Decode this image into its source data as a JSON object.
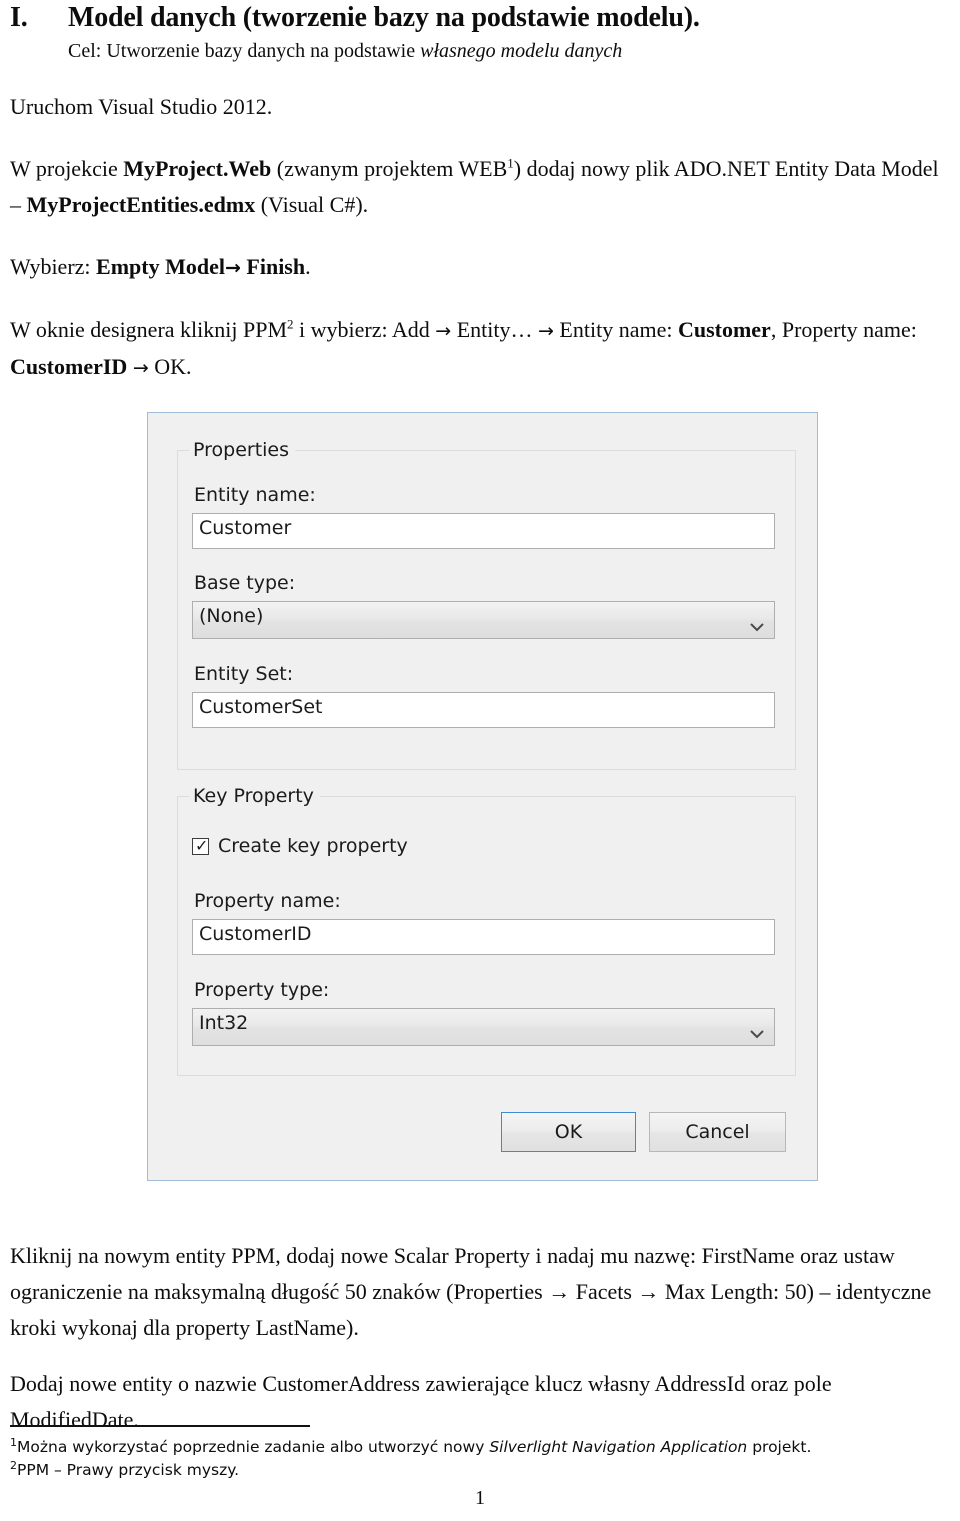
{
  "heading": {
    "number": "I.",
    "title": "Model danych (tworzenie bazy na podstawie modelu).",
    "subtitle_prefix": "Cel: Utworzenie bazy danych na podstawie ",
    "subtitle_italic": "własnego modelu danych"
  },
  "body": {
    "p1": "Uruchom Visual Studio 2012.",
    "p2": {
      "t1": "W projekcie ",
      "b1": "MyProject.Web",
      "t2": " (zwanym projektem WEB",
      "sup1": "1",
      "t3": ") dodaj nowy plik ADO.NET Entity Data Model – ",
      "b2": "MyProjectEntities.edmx",
      "t4": " (Visual C#)."
    },
    "p3": {
      "t1": "Wybierz: ",
      "b1": "Empty Model",
      "arrow1": "→",
      "b2": "Finish",
      "t2": "."
    },
    "p4": {
      "t1": "W oknie designera kliknij PPM",
      "sup1": "2",
      "t2": " i wybierz: Add ",
      "arrow1": "→",
      "t3": " Entity… ",
      "arrow2": "→",
      "t4": " Entity name: ",
      "b1": "Customer",
      "t5": ", Property name: ",
      "b2": "CustomerID",
      "arrow3": "→",
      "t6": " OK."
    },
    "p5": "Kliknij na nowym entity PPM, dodaj nowe Scalar Property i nadaj mu nazwę: FirstName oraz ustaw ograniczenie na maksymalną długość 50 znaków (Properties → Facets → Max Length: 50) – identyczne kroki wykonaj dla property LastName).",
    "p6": "Dodaj nowe entity o nazwie CustomerAddress zawierające klucz własny AddressId oraz pole ModifiedDate."
  },
  "dialog": {
    "groups": {
      "properties_title": "Properties",
      "key_property_title": "Key Property"
    },
    "fields": {
      "entity_name_label": "Entity name:",
      "entity_name_value": "Customer",
      "base_type_label": "Base type:",
      "base_type_value": "(None)",
      "entity_set_label": "Entity Set:",
      "entity_set_value": "CustomerSet",
      "create_key_label": "Create key property",
      "create_key_checked": "✓",
      "property_name_label": "Property name:",
      "property_name_value": "CustomerID",
      "property_type_label": "Property type:",
      "property_type_value": "Int32"
    },
    "buttons": {
      "ok": "OK",
      "cancel": "Cancel"
    },
    "colors": {
      "dialog_bg": "#f0f0f0",
      "dialog_border": "#9fbdd8",
      "default_button_border": "#3d8bcd",
      "field_bg": "#ffffff"
    }
  },
  "footnotes": {
    "one": {
      "marker": "1",
      "t1": "Można wykorzystać poprzednie zadanie albo utworzyć nowy ",
      "i1": "Silverlight Navigation Application",
      "t2": " projekt."
    },
    "two": {
      "marker": "2",
      "text": "PPM – Prawy przycisk myszy."
    }
  },
  "page_number": "1"
}
